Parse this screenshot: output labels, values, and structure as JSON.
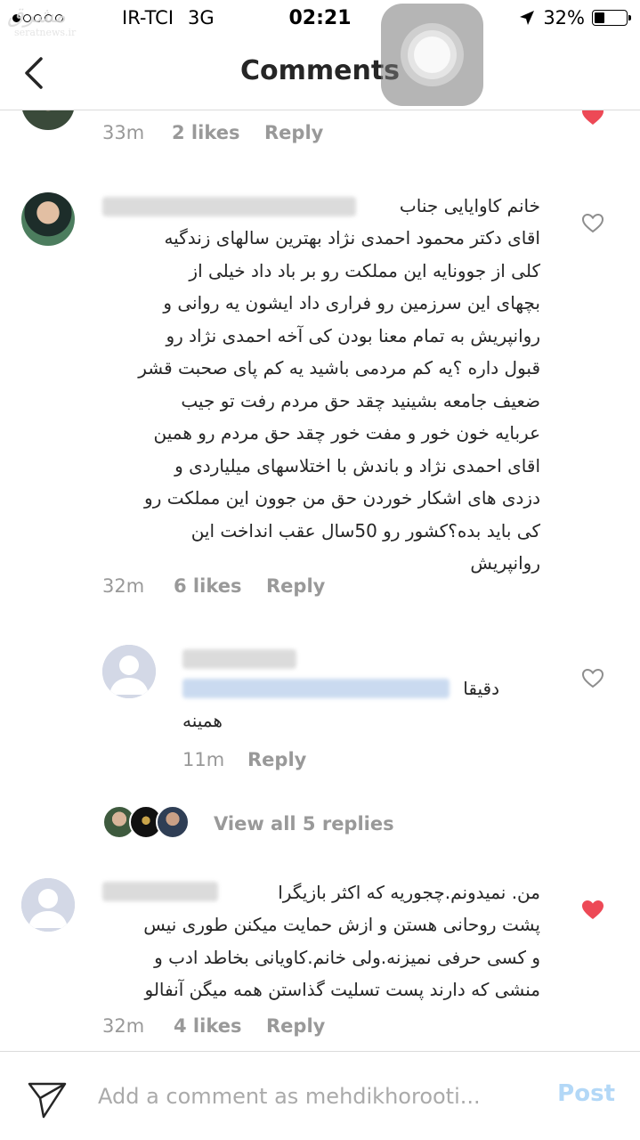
{
  "status_bar": {
    "carrier": "IR-TCI",
    "network": "3G",
    "time": "02:21",
    "battery": "32%",
    "battery_level": 0.32
  },
  "watermark": {
    "logo": "مشرق",
    "site": "seratnews.ir"
  },
  "header": {
    "title": "Comments"
  },
  "comments": [
    {
      "time": "33m",
      "likes": "2 likes",
      "reply": "Reply",
      "liked": true
    },
    {
      "time": "32m",
      "likes": "6 likes",
      "reply": "Reply",
      "liked": false,
      "lines": [
        "خانم کاوایایی جناب",
        "اقای دکتر محمود احمدی نژاد بهترین سالهای زندگیه",
        "کلی از جوونایه این مملکت رو بر باد داد خیلی از",
        "بچهای این سرزمین رو فراری داد ایشون یه روانی و",
        "روانپریش به تمام معنا بودن کی آخه احمدی نژاد رو",
        "قبول داره ؟یه کم مردمی باشید یه کم پای صحبت قشر",
        "ضعیف جامعه بشینید چقد حق مردم رفت تو جیب",
        "عربایه خون خور و مفت خور چقد حق مردم رو همین",
        "اقای احمدی نژاد و باندش با اختلاسهای میلیاردی و",
        "دزدی های اشکار خوردن حق من جوون این مملکت رو",
        "کی باید بده؟کشور رو 50سال عقب انداخت این",
        "روانپریش"
      ]
    },
    {
      "time": "11m",
      "reply": "Reply",
      "liked": false,
      "lines": [
        "دقیقا",
        "همینه"
      ]
    },
    {
      "time": "32m",
      "likes": "4 likes",
      "reply": "Reply",
      "liked": true,
      "lines": [
        "من. نمیدونم.چجوریه که اکثر بازیگرا",
        "پشت روحانی هستن و ازش حمایت میکنن طوری نیس",
        "و کسی حرفی نمیزنه.ولی خانم.کاویانی بخاطد ادب و",
        "منشی که دارند پست تسلیت گذاستن همه میگن آنفالو"
      ]
    }
  ],
  "view_replies": "View all 5 replies",
  "composer": {
    "placeholder": "Add a comment as mehdikhorooti...",
    "post_label": "Post"
  },
  "colors": {
    "heart_liked": "#ed4956",
    "post_disabled": "#b3d8f7",
    "meta_gray": "#999999"
  }
}
